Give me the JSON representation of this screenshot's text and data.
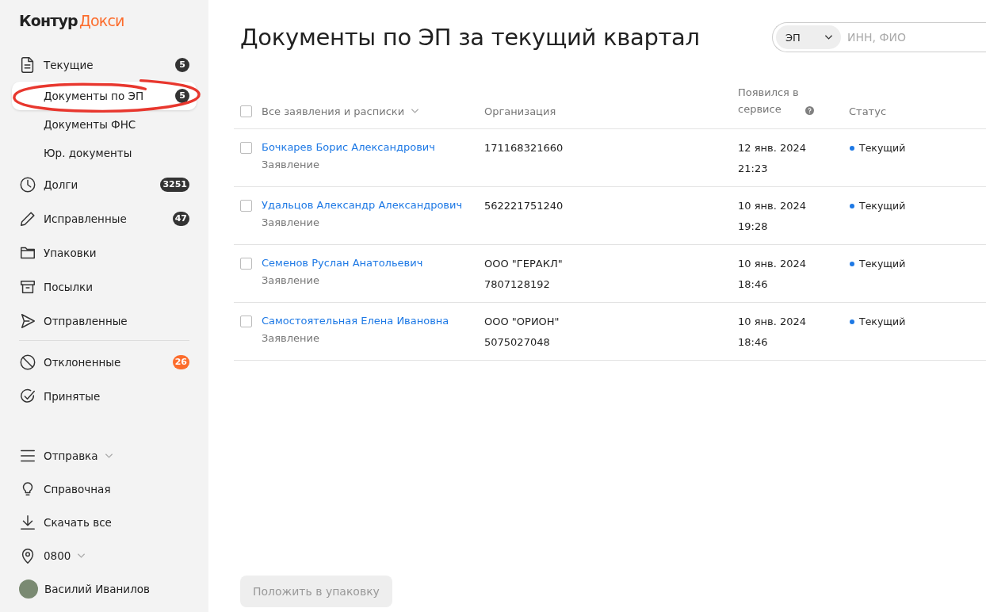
{
  "logo": {
    "brand": "Контур",
    "product": "Докси"
  },
  "nav_groups": [
    {
      "items": [
        {
          "label": "Текущие",
          "badge": "5",
          "color": "#333333",
          "selected": false,
          "circled": false,
          "children": [
            {
              "label": "Документы по ЭП",
              "badge": "5",
              "color": "#333333",
              "selected": true,
              "circled": true
            },
            {
              "label": "Документы ФНС",
              "selected": false,
              "circled": false
            },
            {
              "label": "Юр. документы",
              "selected": false,
              "circled": false
            }
          ]
        },
        {
          "label": "Долги",
          "badge": "3251",
          "color": "#333333",
          "selected": false,
          "circled": false
        },
        {
          "label": "Исправленные",
          "badge": "47",
          "color": "#333333",
          "selected": false,
          "circled": false
        },
        {
          "label": "Упаковки",
          "selected": false,
          "circled": false
        },
        {
          "label": "Посылки",
          "selected": false,
          "circled": false
        },
        {
          "label": "Отправленные",
          "selected": false,
          "circled": false
        }
      ]
    },
    {
      "items": [
        {
          "label": "Отклоненные",
          "badge": "26",
          "color": "#fc6c2c",
          "selected": false,
          "circled": false
        },
        {
          "label": "Принятые",
          "selected": false,
          "circled": false
        }
      ]
    }
  ],
  "bottom_menu": [
    {
      "label": "Отправка",
      "dropdown": true
    },
    {
      "label": "Справочная",
      "dropdown": false
    },
    {
      "label": "Скачать все",
      "dropdown": false
    },
    {
      "label": "0800",
      "dropdown": true
    }
  ],
  "user": {
    "name": "Василий Иванилов"
  },
  "title": "Документы по ЭП за текущий квартал",
  "search": {
    "filter": "ЭП",
    "placeholder": "ИНН, ФИО"
  },
  "table": {
    "select_all": {
      "checked": false
    },
    "columns": [
      {
        "label": "Все заявления и расписки",
        "dropdown": true,
        "help": false
      },
      {
        "label": "Организация",
        "dropdown": false,
        "help": false
      },
      {
        "label": "Появился в сервисе",
        "dropdown": false,
        "help": true
      },
      {
        "label": "Статус",
        "dropdown": false,
        "help": false
      }
    ],
    "rows": [
      {
        "checked": false,
        "name": "Бочкарев Борис Александрович",
        "type": "Заявление",
        "organization": [
          "171168321660"
        ],
        "date": "12 янв. 2024",
        "time": "21:23",
        "status": "Текущий",
        "color": "#1e79e5"
      },
      {
        "checked": false,
        "name": "Удальцов Александр Александрович",
        "type": "Заявление",
        "organization": [
          "562221751240"
        ],
        "date": "10 янв. 2024",
        "time": "19:28",
        "status": "Текущий",
        "color": "#1e79e5"
      },
      {
        "checked": false,
        "name": "Семенов Руслан Анатольевич",
        "type": "Заявление",
        "organization": [
          "ООО \"ГЕРАКЛ\"",
          "7807128192"
        ],
        "date": "10 янв. 2024",
        "time": "18:46",
        "status": "Текущий",
        "color": "#1e79e5"
      },
      {
        "checked": false,
        "name": "Самостоятельная Елена Ивановна",
        "type": "Заявление",
        "organization": [
          "ООО \"ОРИОН\"",
          "5075027048"
        ],
        "date": "10 янв. 2024",
        "time": "18:46",
        "status": "Текущий",
        "color": "#1e79e5"
      }
    ]
  },
  "action_button": {
    "label": "Положить в упаковку",
    "disabled": true
  }
}
